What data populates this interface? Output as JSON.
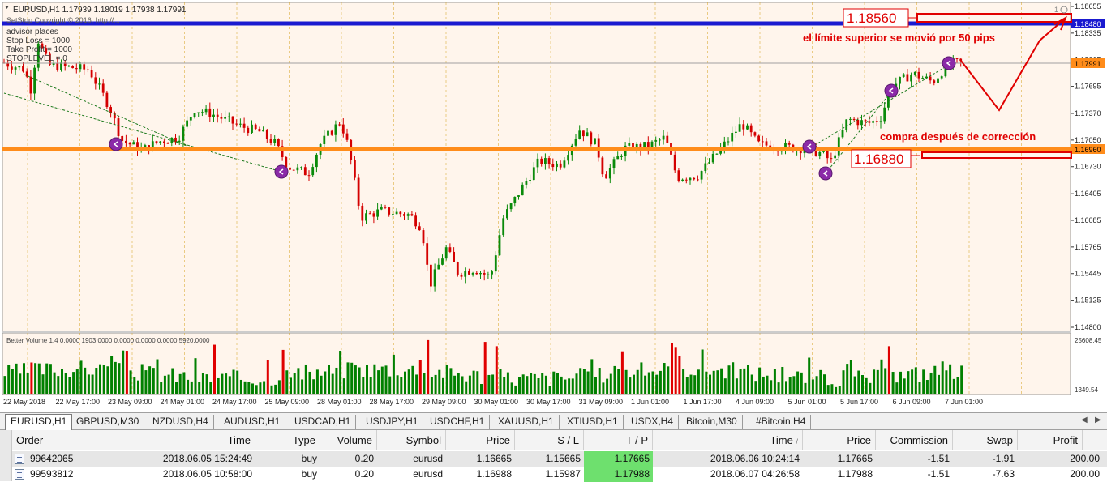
{
  "chart": {
    "header": {
      "symbol_line": "EURUSD,H1  1.17939 1.18019 1.17938 1.17991",
      "ea_line": "SetStop   Copyright © 2016, http://...",
      "advisor_lines": [
        "advisor places",
        "Stop Loss      = 1000",
        "Take Profit    = 1000",
        "STOPLEVEL    = 0"
      ]
    },
    "price_labels": [
      "1.18655",
      "1.18335",
      "1.18015",
      "1.17695",
      "1.17370",
      "1.17050",
      "1.16730",
      "1.16405",
      "1.16085",
      "1.15765",
      "1.15445",
      "1.15125",
      "1.14800"
    ],
    "level_labels": {
      "blue": "1.18480",
      "current": "1.17991",
      "orange": "1.16960"
    },
    "annotations": {
      "upper_box": "1.18560",
      "lower_box": "1.16880",
      "upper_text": "el límite superior se movió por 50 pips",
      "lower_text": "compra después de corrección",
      "corner_marker": "1"
    },
    "volume": {
      "title": "Better Volume 1.4 0.0000 1903.0000 0.0000 0.0000 0.0000 5920.0000",
      "top_label": "25608.45",
      "bottom_label": "1349.54"
    },
    "time_labels": [
      "22 May 2018",
      "22 May 17:00",
      "23 May 09:00",
      "24 May 01:00",
      "24 May 17:00",
      "25 May 09:00",
      "28 May 01:00",
      "28 May 17:00",
      "29 May 09:00",
      "30 May 01:00",
      "30 May 17:00",
      "31 May 09:00",
      "1 Jun 01:00",
      "1 Jun 17:00",
      "4 Jun 09:00",
      "5 Jun 01:00",
      "5 Jun 17:00",
      "6 Jun 09:00",
      "7 Jun 01:00"
    ],
    "colors": {
      "background": "#fff5ec",
      "bull": "#0a8a0a",
      "bear": "#d40000",
      "vol_red": "#e00000",
      "vol_green": "#008000",
      "blue_line": "#1a1ad0",
      "orange_line": "#ff8c1a",
      "annotation_red": "#e00000",
      "grid": "#d4a017",
      "marker": "#8b2aa8"
    }
  },
  "tabs": [
    "EURUSD,H1",
    "GBPUSD,M30",
    "NZDUSD,H4",
    "AUDUSD,H1",
    "USDCAD,H1",
    "USDJPY,H1",
    "USDCHF,H1",
    "XAUUSD,H1",
    "XTIUSD,H1",
    "USDX,H4",
    "Bitcoin,M30",
    "#Bitcoin,H4"
  ],
  "table": {
    "headers": [
      "Order",
      "Time",
      "Type",
      "Volume",
      "Symbol",
      "Price",
      "S / L",
      "T / P",
      "Time",
      "Price",
      "Commission",
      "Swap",
      "Profit"
    ],
    "rows": [
      [
        "99642065",
        "2018.06.05 15:24:49",
        "buy",
        "0.20",
        "eurusd",
        "1.16665",
        "1.15665",
        "1.17665",
        "2018.06.06 10:24:14",
        "1.17665",
        "-1.51",
        "-1.91",
        "200.00"
      ],
      [
        "99593812",
        "2018.06.05 10:58:00",
        "buy",
        "0.20",
        "eurusd",
        "1.16988",
        "1.15987",
        "1.17988",
        "2018.06.07 04:26:58",
        "1.17988",
        "-1.51",
        "-7.63",
        "200.00"
      ]
    ]
  }
}
